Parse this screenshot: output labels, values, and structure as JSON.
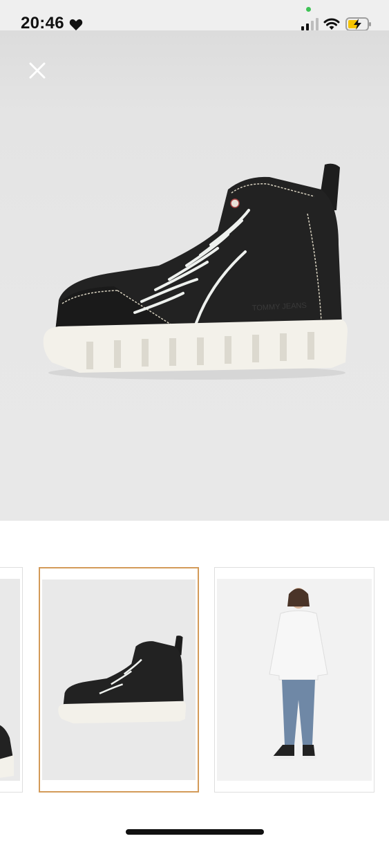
{
  "status_bar": {
    "time": "20:46",
    "icons": [
      "heart-icon",
      "privacy-dot",
      "signal-icon",
      "wifi-icon",
      "battery-charging-icon"
    ]
  },
  "viewer": {
    "close_icon": "close-icon",
    "brand_on_shoe": "TOMMY JEANS"
  },
  "thumbnails": [
    {
      "id": "thumb-1",
      "selected": false,
      "subject": "shoe"
    },
    {
      "id": "thumb-2",
      "selected": true,
      "subject": "shoe"
    },
    {
      "id": "thumb-3",
      "selected": false,
      "subject": "model"
    }
  ],
  "colors": {
    "selected_border": "#d39a58",
    "privacy_dot": "#3fc356",
    "battery_fill": "#f5c400",
    "shoe_upper": "#222222",
    "sole": "#f3f1ea"
  }
}
